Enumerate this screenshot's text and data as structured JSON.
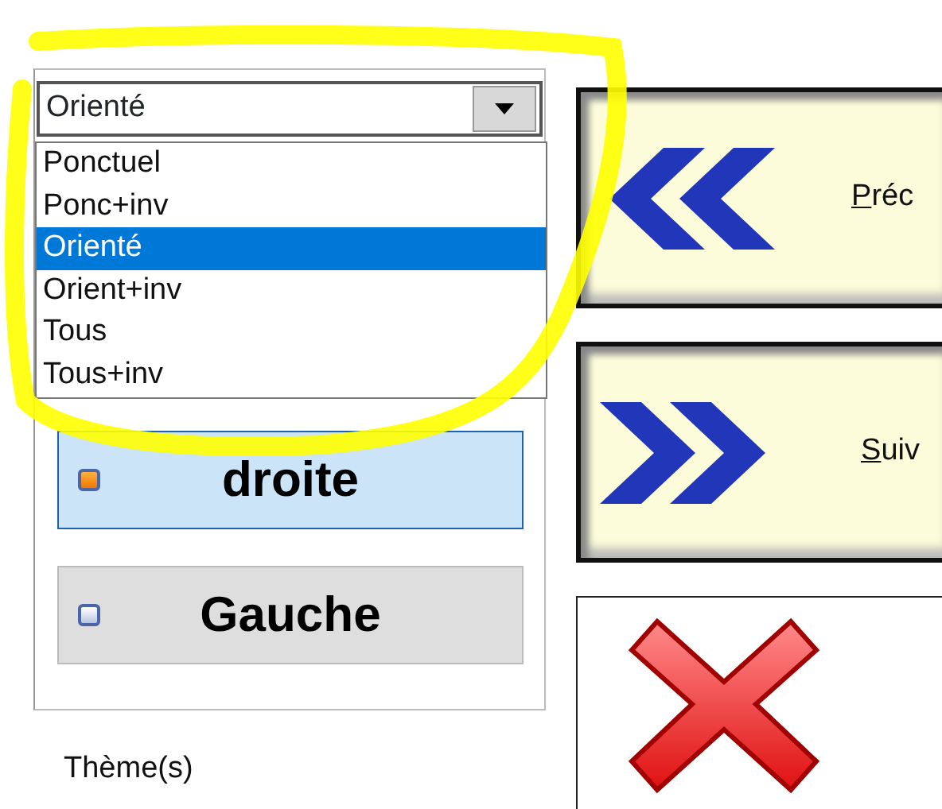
{
  "combo": {
    "value": "Orienté",
    "expanded": true,
    "options": [
      {
        "label": "Ponctuel",
        "selected": false
      },
      {
        "label": "Ponc+inv",
        "selected": false
      },
      {
        "label": "Orienté",
        "selected": true
      },
      {
        "label": "Orient+inv",
        "selected": false
      },
      {
        "label": "Tous",
        "selected": false
      },
      {
        "label": "Tous+inv",
        "selected": false
      }
    ]
  },
  "toggles": [
    {
      "label": "droite",
      "selected": true
    },
    {
      "label": "Gauche",
      "selected": false
    }
  ],
  "theme_label": "Thème(s)",
  "nav_buttons": [
    {
      "kind": "previous",
      "label": "Préc"
    },
    {
      "kind": "next",
      "label": "Suiv"
    },
    {
      "kind": "cancel"
    }
  ]
}
